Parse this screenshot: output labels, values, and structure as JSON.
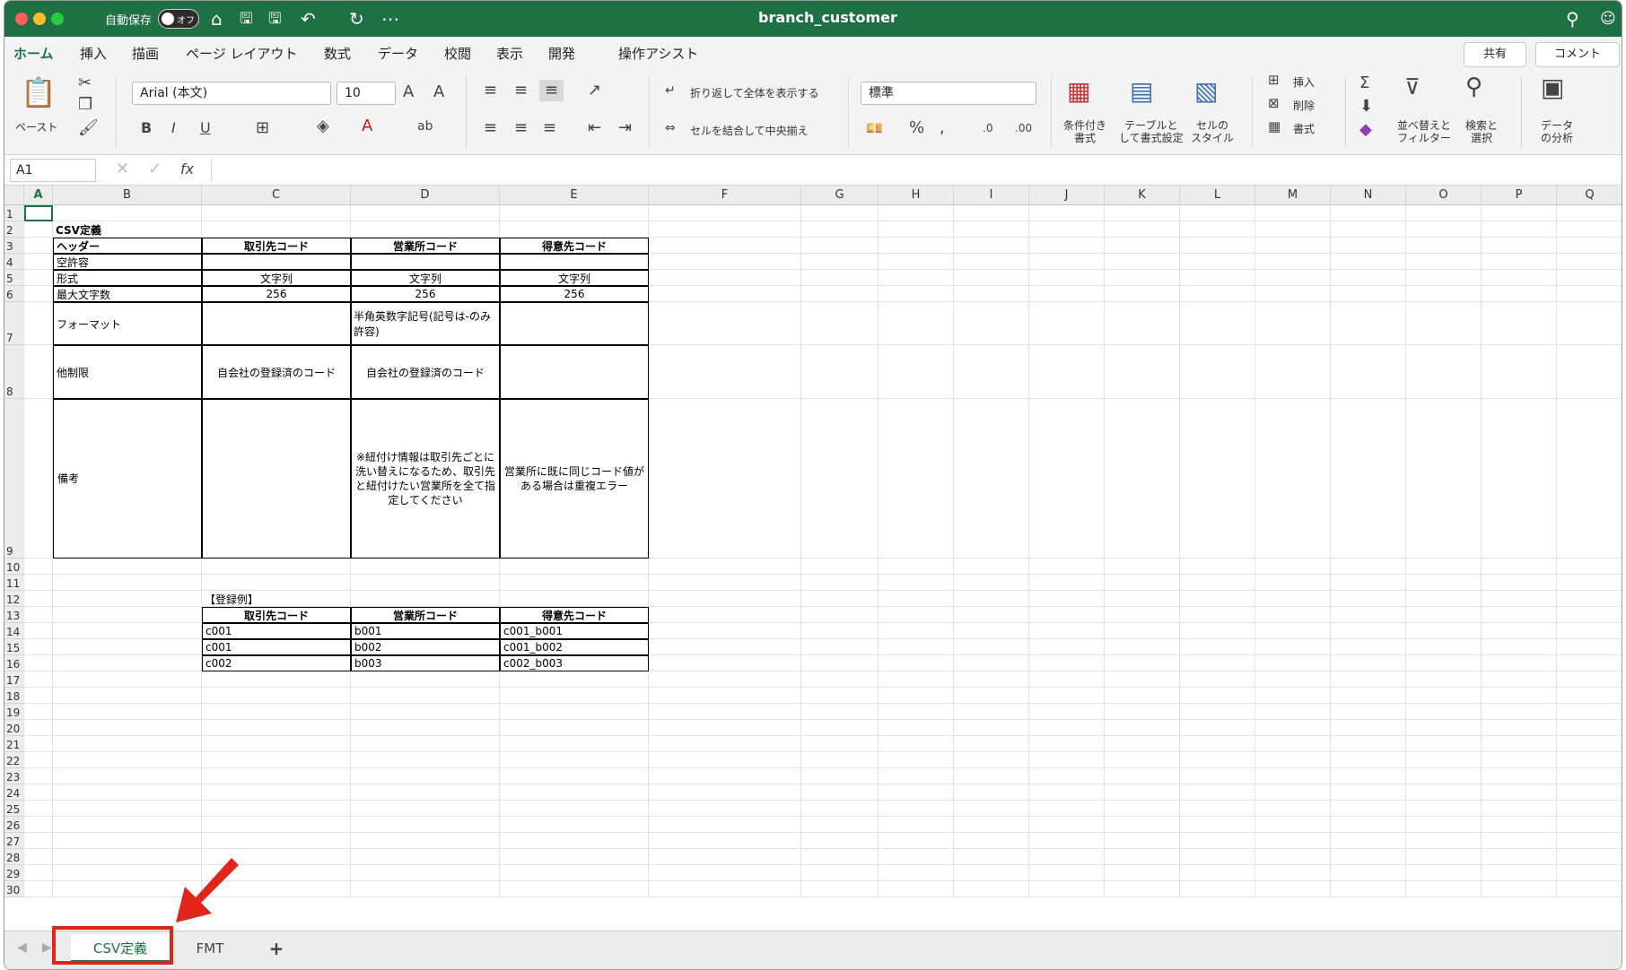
{
  "window": {
    "title": "branch_customer",
    "autosave_label": "自動保存",
    "autosave_state": "オフ"
  },
  "ribbon_tabs": [
    "ホーム",
    "挿入",
    "描画",
    "ページ レイアウト",
    "数式",
    "データ",
    "校閲",
    "表示",
    "開発",
    "操作アシスト"
  ],
  "share_label": "共有",
  "comment_label": "コメント",
  "ribbon": {
    "paste": "ペースト",
    "font_name": "Arial (本文)",
    "font_size": "10",
    "wrap": "折り返して全体を表示する",
    "merge": "セルを結合して中央揃え",
    "number_format": "標準",
    "cond_format": [
      "条件付き",
      "書式"
    ],
    "table_format": [
      "テーブルと",
      "して書式設定"
    ],
    "cell_style": [
      "セルの",
      "スタイル"
    ],
    "insert": "挿入",
    "delete": "削除",
    "format": "書式",
    "sort_filter": [
      "並べ替えと",
      "フィルター"
    ],
    "find": [
      "検索と",
      "選択"
    ],
    "analyze": [
      "データ",
      "の分析"
    ]
  },
  "formula_bar": {
    "name_box": "A1",
    "fx": "fx",
    "formula": ""
  },
  "columns": [
    "A",
    "B",
    "C",
    "D",
    "E",
    "F",
    "G",
    "H",
    "I",
    "J",
    "K",
    "L",
    "M",
    "N",
    "O",
    "P",
    "Q"
  ],
  "sheet": {
    "title": "CSV定義",
    "header_row": [
      "ヘッダー",
      "取引先コード",
      "営業所コード",
      "得意先コード"
    ],
    "rows": [
      [
        "空許容",
        "",
        "",
        ""
      ],
      [
        "形式",
        "文字列",
        "文字列",
        "文字列"
      ],
      [
        "最大文字数",
        "256",
        "256",
        "256"
      ],
      [
        "フォーマット",
        "",
        "半角英数字記号(記号は-のみ許容)",
        ""
      ],
      [
        "他制限",
        "自会社の登録済のコード",
        "自会社の登録済のコード",
        ""
      ],
      [
        "備考",
        "",
        "※紐付け情報は取引先ごとに洗い替えになるため、取引先と紐付けたい営業所を全て指定してください",
        "営業所に既に同じコード値がある場合は重複エラー"
      ]
    ],
    "example_title": "【登録例】",
    "example_header": [
      "取引先コード",
      "営業所コード",
      "得意先コード"
    ],
    "example_rows": [
      [
        "c001",
        "b001",
        "c001_b001"
      ],
      [
        "c001",
        "b002",
        "c001_b002"
      ],
      [
        "c002",
        "b003",
        "c002_b003"
      ]
    ]
  },
  "sheet_tabs": [
    "CSV定義",
    "FMT"
  ],
  "add_sheet": "+"
}
